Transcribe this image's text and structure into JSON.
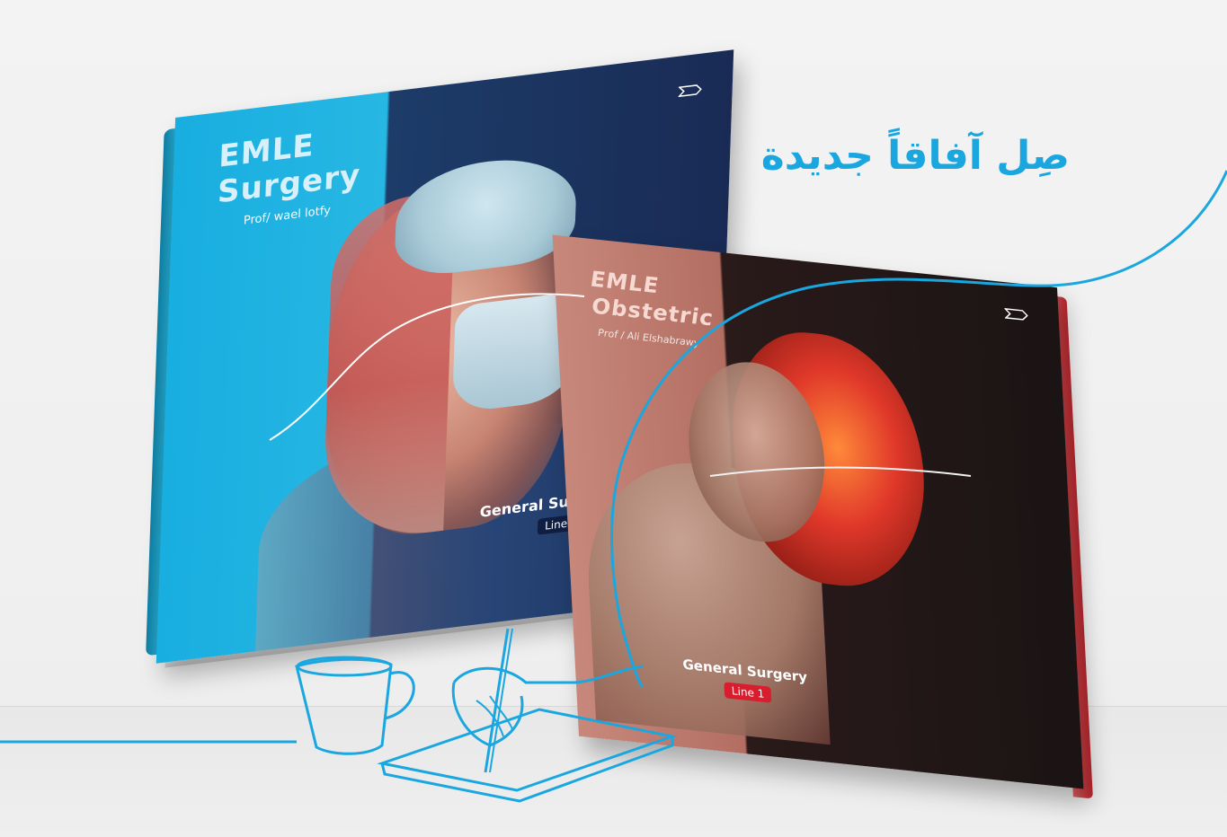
{
  "headline": "صِل آفاقاً جديدة",
  "book1": {
    "title_line1": "EMLE",
    "title_line2": "Surgery",
    "author": "Prof/ wael lotfy",
    "subtitle": "General Surgery",
    "line_label": "Line 2"
  },
  "book2": {
    "title_line1": "EMLE",
    "title_line2": "Obstetric",
    "author": "Prof / Ali Elshabrawy",
    "subtitle": "General Surgery",
    "line_label": "Line 1"
  },
  "colors": {
    "accent": "#1aa7e0",
    "book1_cover_left": "#27b7e3",
    "book1_cover_right": "#192b55",
    "book2_cover_left": "#b36e62",
    "book2_cover_right": "#1b1414",
    "book2_spine": "#c5272f",
    "line2_badge": "#0f1e42",
    "line1_badge": "#d81e2e"
  },
  "icons": {
    "logo": "emle-logo-icon",
    "illustration": "hand-writing-notebook-and-cup-icon"
  }
}
